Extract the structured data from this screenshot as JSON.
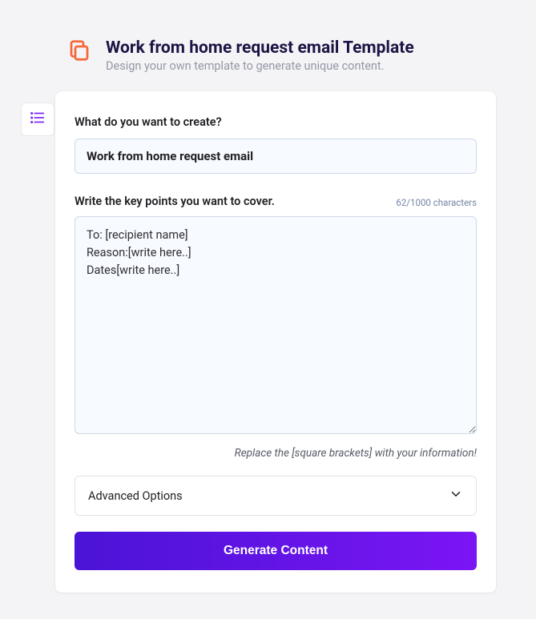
{
  "header": {
    "title": "Work from home request email Template",
    "subtitle": "Design your own template to generate unique content."
  },
  "form": {
    "create_label": "What do you want to create?",
    "create_value": "Work from home request email",
    "keypoints_label": "Write the key points you want to cover.",
    "keypoints_value": "To: [recipient name]\nReason:[write here..]\nDates[write here..]",
    "char_counter": "62/1000 characters",
    "hint": "Replace the [square brackets] with your information!",
    "advanced_label": "Advanced Options",
    "generate_label": "Generate Content"
  },
  "colors": {
    "accent_orange": "#f6683b",
    "accent_purple": "#7b15f5",
    "gradient_start": "#4a14d6",
    "gradient_end": "#7b15f5"
  }
}
